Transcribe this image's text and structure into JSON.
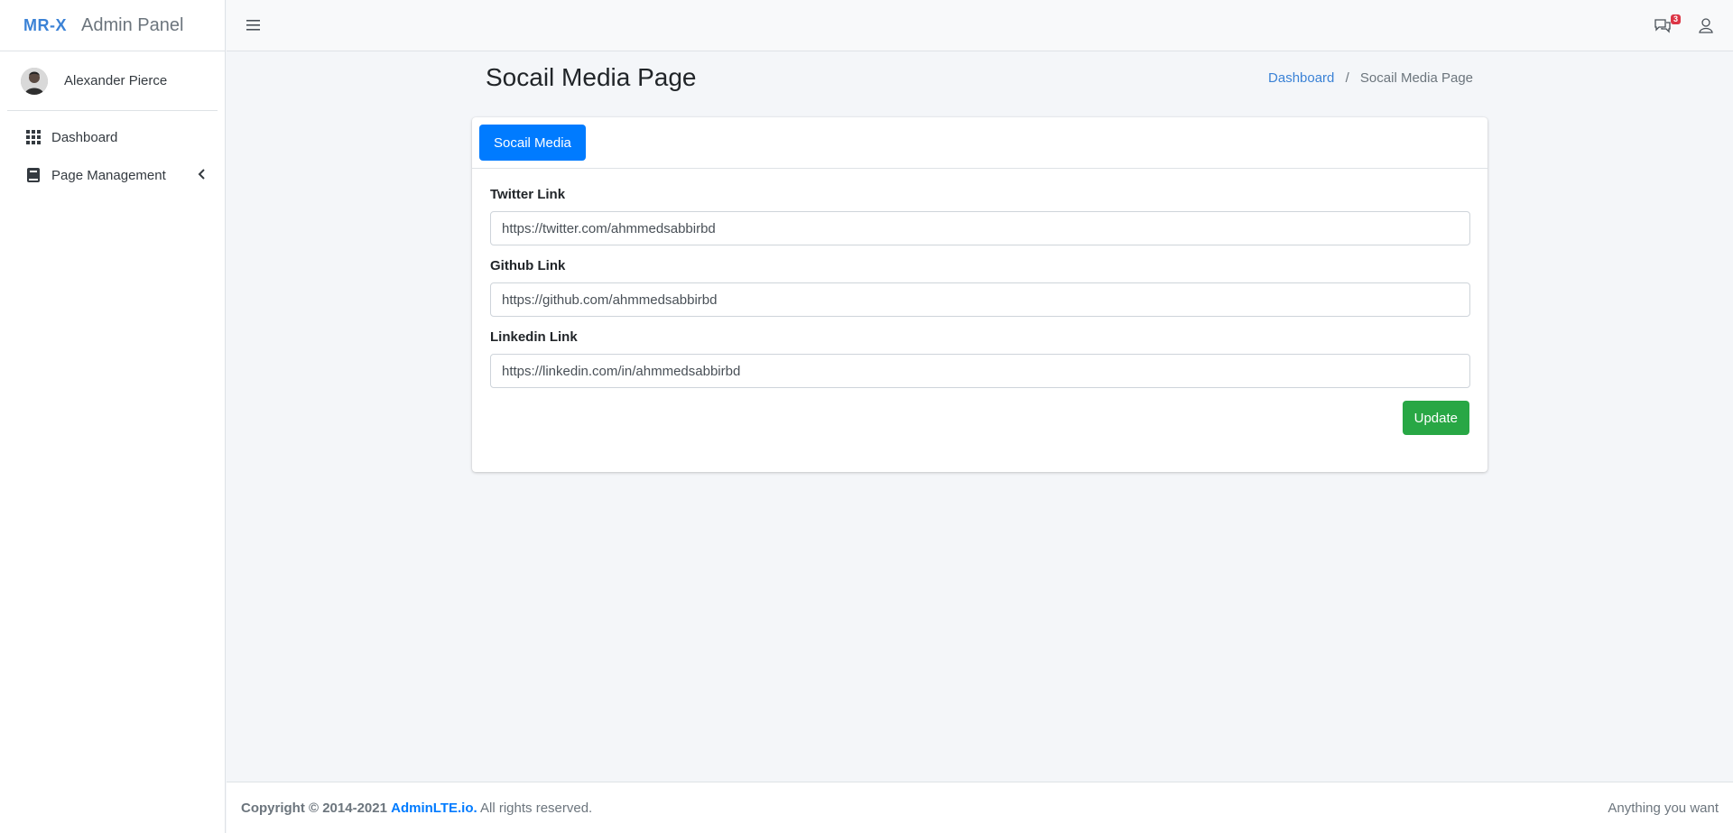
{
  "brand": {
    "logo": "MR-X",
    "title": "Admin Panel"
  },
  "user": {
    "name": "Alexander Pierce"
  },
  "sidebar": {
    "items": [
      {
        "label": "Dashboard",
        "icon": "grid-icon"
      },
      {
        "label": "Page Management",
        "icon": "book-icon"
      }
    ]
  },
  "topbar": {
    "messages_count": "3"
  },
  "header": {
    "title": "Socail Media Page",
    "breadcrumb": {
      "home": "Dashboard",
      "separator": "/",
      "current": "Socail Media Page"
    }
  },
  "card": {
    "tab_label": "Socail Media",
    "fields": [
      {
        "label": "Twitter Link",
        "value": "https://twitter.com/ahmmedsabbirbd"
      },
      {
        "label": "Github Link",
        "value": "https://github.com/ahmmedsabbirbd"
      },
      {
        "label": "Linkedin Link",
        "value": "https://linkedin.com/in/ahmmedsabbirbd"
      }
    ],
    "submit_label": "Update"
  },
  "footer": {
    "copyright_prefix": "Copyright © 2014-2021",
    "brand_link": "AdminLTE.io.",
    "rights": "All rights reserved.",
    "right_text": "Anything you want"
  },
  "colors": {
    "primary": "#007bff",
    "success": "#28a745",
    "danger": "#dc3545",
    "brand": "#3b82d6"
  }
}
